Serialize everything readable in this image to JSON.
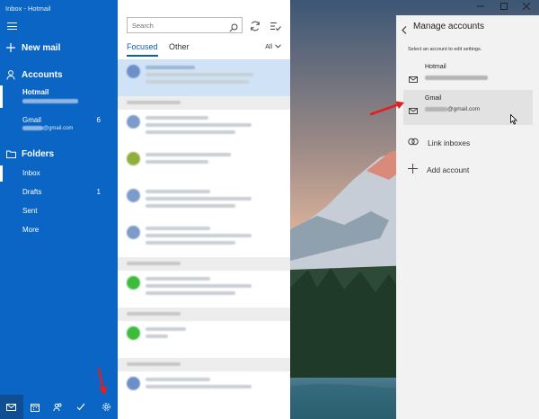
{
  "window": {
    "title": "Inbox - Hotmail"
  },
  "nav": {
    "new_mail": "New mail",
    "accounts_label": "Accounts",
    "accounts": [
      {
        "name": "Hotmail",
        "email": "",
        "count": ""
      },
      {
        "name": "Gmail",
        "email": "@gmail.com",
        "count": "6"
      }
    ],
    "folders_label": "Folders",
    "folders": [
      {
        "name": "Inbox",
        "count": ""
      },
      {
        "name": "Drafts",
        "count": "1"
      },
      {
        "name": "Sent",
        "count": ""
      },
      {
        "name": "More",
        "count": ""
      }
    ],
    "bottom_icons": [
      "mail-icon",
      "calendar-icon",
      "people-icon",
      "todo-icon",
      "settings-icon"
    ]
  },
  "list": {
    "search_placeholder": "Search",
    "tabs": {
      "focused": "Focused",
      "other": "Other"
    },
    "filter": "All",
    "avatar_colors": [
      "#6d8fc7",
      "#7b9bc9",
      "#8fae3c",
      "#7b9bc9",
      "#7b9bc9",
      "#3dbb3d",
      "#3dbb3d",
      "#6d8fc7",
      "#3dbb3d"
    ]
  },
  "settings": {
    "title": "Manage accounts",
    "subtitle": "Select an account to edit settings.",
    "accounts": [
      {
        "name": "Hotmail",
        "email": ""
      },
      {
        "name": "Gmail",
        "email": "@gmail.com"
      }
    ],
    "link_inboxes": "Link inboxes",
    "add_account": "Add account"
  },
  "colors": {
    "nav_bg": "#0a65c4",
    "accent": "#0b5eb8",
    "pane_bg": "#f2f2f2",
    "arrow": "#e02020"
  }
}
